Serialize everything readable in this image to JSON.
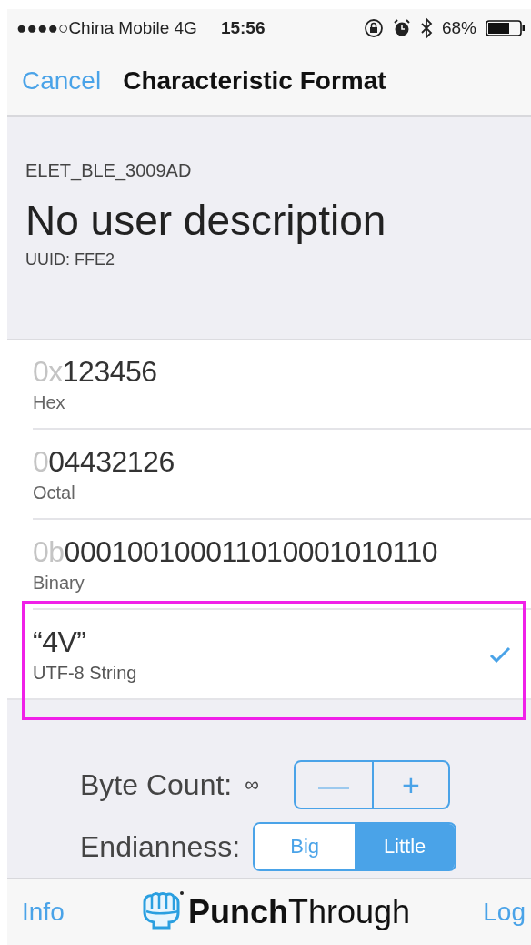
{
  "status_bar": {
    "carrier": "●●●●○China Mobile 4G",
    "time": "15:56",
    "battery": "68%"
  },
  "nav_bar": {
    "cancel": "Cancel",
    "title": "Characteristic Format"
  },
  "header": {
    "device": "ELET_BLE_3009AD",
    "description": "No user description",
    "uuid": "UUID: FFE2"
  },
  "formats": [
    {
      "prefix": "0x",
      "value": "123456",
      "label": "Hex",
      "selected": false
    },
    {
      "prefix": "0",
      "value": "04432126",
      "label": "Octal",
      "selected": false
    },
    {
      "prefix": "0b",
      "value": "000100100011010001010110",
      "label": "Binary",
      "selected": false
    },
    {
      "value": "“4V”",
      "label": "UTF-8 String",
      "selected": true
    }
  ],
  "highlight": {
    "on": true
  },
  "byte_count": {
    "label": "Byte Count:",
    "value": "∞",
    "steppers": [
      {
        "symbol": "—",
        "disabled": true
      },
      {
        "symbol": "+",
        "disabled": false
      }
    ]
  },
  "endianness": {
    "label": "Endianness:",
    "options": [
      {
        "label": "Big",
        "selected": false
      },
      {
        "label": "Little",
        "selected": true
      }
    ]
  },
  "tab_bar": {
    "info": "Info",
    "brand": "**Punch**Through",
    "log": "Log"
  }
}
